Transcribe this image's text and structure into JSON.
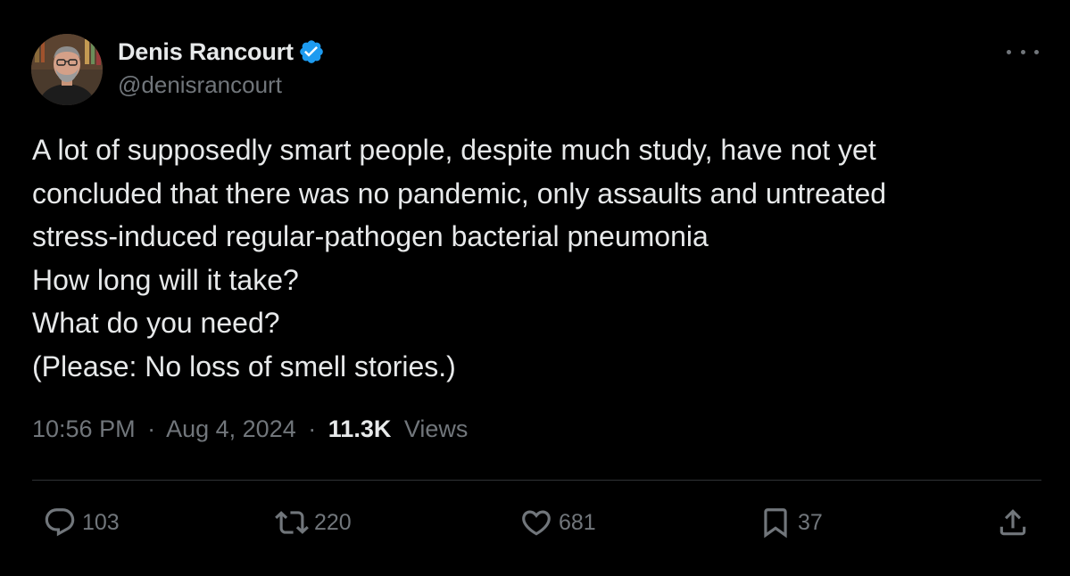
{
  "author": {
    "display_name": "Denis Rancourt",
    "handle": "@denisrancourt",
    "verified": true
  },
  "tweet": {
    "lines": [
      "A lot of supposedly smart people, despite much study, have not yet",
      "concluded that there was no pandemic, only assaults and untreated",
      "stress-induced regular-pathogen bacterial pneumonia",
      "How long will it take?",
      "What do you need?",
      "(Please: No loss of smell stories.)"
    ],
    "time": "10:56 PM",
    "date": "Aug 4, 2024",
    "separator": "·",
    "views_count": "11.3K",
    "views_label": "Views"
  },
  "actions": {
    "replies": "103",
    "reposts": "220",
    "likes": "681",
    "bookmarks": "37"
  },
  "icons": {
    "verified": "verified-badge-icon",
    "more": "more-options-icon",
    "reply": "reply-icon",
    "repost": "repost-icon",
    "like": "heart-icon",
    "bookmark": "bookmark-icon",
    "share": "share-icon"
  },
  "colors": {
    "background": "#000000",
    "text_primary": "#e7e9ea",
    "text_secondary": "#71767b",
    "verified_blue": "#1d9bf0",
    "divider": "#2f3336"
  }
}
